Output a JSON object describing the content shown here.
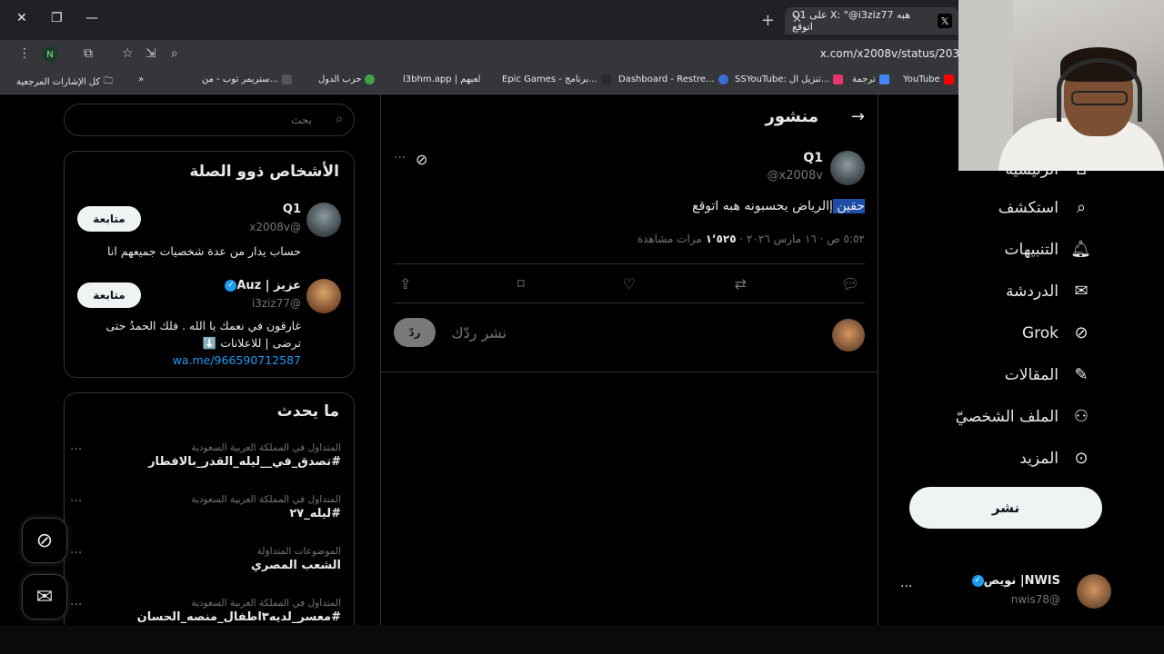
{
  "browser": {
    "tab_title": "Q1 على X: \"@i3ziz77 هبه اتوقع",
    "url": "x.com/x2008v/status/203",
    "bookmarks": [
      {
        "label": "YouTube",
        "color": "#ff0000"
      },
      {
        "label": "ترجمة",
        "color": "#4285f4"
      },
      {
        "label": "SSYouTube: تنزيل ال...",
        "color": "#e8336d"
      },
      {
        "label": "Dashboard - Restre...",
        "color": "#3a6fd8"
      },
      {
        "label": "Epic Games - برنامج...",
        "color": "#6b3fd6"
      },
      {
        "label": "l3bhm.app | لعبهم",
        "color": "#2c2c2c"
      },
      {
        "label": "حرب الدول",
        "color": "#3ea34a"
      },
      {
        "label": "ستريمر توب - من...",
        "color": "#555555"
      }
    ],
    "all_bookmarks": "كل الإشارات المرجعية",
    "profile_initial": "N"
  },
  "search": {
    "placeholder": "بحث"
  },
  "related": {
    "title": "الأشخاص ذوو الصلة",
    "people": [
      {
        "name": "Q1",
        "handle": "@x2008v",
        "bio": "حساب يدار من عدة شخصيات جميعهم انا",
        "follow": "متابعة"
      },
      {
        "name": "عزيز | Auz",
        "handle": "@i3ziz77",
        "bio": "غارقون في نعمك يا الله . فلك الحمدُ حتى ترضى | للاعلانات ⬇️",
        "link": "wa.me/966590712587",
        "follow": "متابعة"
      }
    ]
  },
  "trends": {
    "title": "ما يحدث",
    "items": [
      {
        "meta": "المتداول في المملكة العربية السعودية",
        "title": "#تصدق_في__ليله_القدر_بالافطار"
      },
      {
        "meta": "المتداول في المملكة العربية السعودية",
        "title": "#ليله_٢٧"
      },
      {
        "meta": "الموضوعات المتداوَلة",
        "title": "الشعب المصري"
      },
      {
        "meta": "المتداول في المملكة العربية السعودية",
        "title": "#معسر_لديه٣اطفال_منصه_الحسان"
      }
    ]
  },
  "post": {
    "header": "منشور",
    "author_name": "Q1",
    "author_handle": "@x2008v",
    "text_selected": "حقين ",
    "text_rest": "إالرياض يحسبونه هبه اتوقع",
    "time": "٥:٥٢ ص · ١٦ مارس ٢٠٢٦ · ",
    "views": "١٬٥٢٥",
    "views_label": " مرات مشاهدة",
    "reply_placeholder": "نشر ردّك",
    "reply_button": "ردّ"
  },
  "nav": {
    "items": [
      {
        "label": "الرئيسية",
        "icon": "home-icon"
      },
      {
        "label": "استكشف",
        "icon": "search-icon"
      },
      {
        "label": "التنبيهات",
        "icon": "bell-icon"
      },
      {
        "label": "الدردشة",
        "icon": "mail-icon"
      },
      {
        "label": "Grok",
        "icon": "grok-icon"
      },
      {
        "label": "المقالات",
        "icon": "article-icon"
      },
      {
        "label": "الملف الشخصيّ",
        "icon": "person-icon"
      },
      {
        "label": "المزيد",
        "icon": "more-icon"
      }
    ],
    "post_button": "نشر",
    "account_name": "NWIS| نويص",
    "account_handle": "@nwis78"
  },
  "colors": {
    "accent": "#1d9bf0",
    "background": "#000000",
    "border": "#2f3336",
    "muted": "#71767b"
  }
}
